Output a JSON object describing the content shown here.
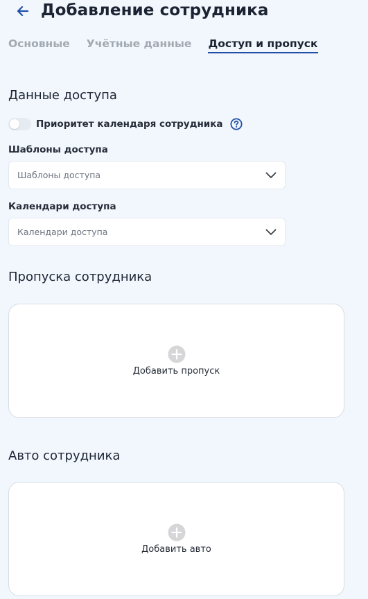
{
  "header": {
    "title": "Добавление сотрудника",
    "back_icon": "arrow-left-icon"
  },
  "tabs": [
    {
      "label": "Основные",
      "active": false
    },
    {
      "label": "Учётные данные",
      "active": false
    },
    {
      "label": "Доступ и пропуск",
      "active": true
    }
  ],
  "access": {
    "section_title": "Данные доступа",
    "priority_toggle": {
      "label": "Приоритет календаря сотрудника",
      "enabled": false
    },
    "templates": {
      "label": "Шаблоны доступа",
      "placeholder": "Шаблоны доступа"
    },
    "calendars": {
      "label": "Календари доступа",
      "placeholder": "Календари доступа"
    }
  },
  "passes": {
    "section_title": "Пропуска сотрудника",
    "add_label": "Добавить пропуск"
  },
  "cars": {
    "section_title": "Авто сотрудника",
    "add_label": "Добавить авто"
  },
  "colors": {
    "accent": "#1f4fa7",
    "background": "#f2f7fd",
    "muted_tab": "#a3a9b2"
  }
}
